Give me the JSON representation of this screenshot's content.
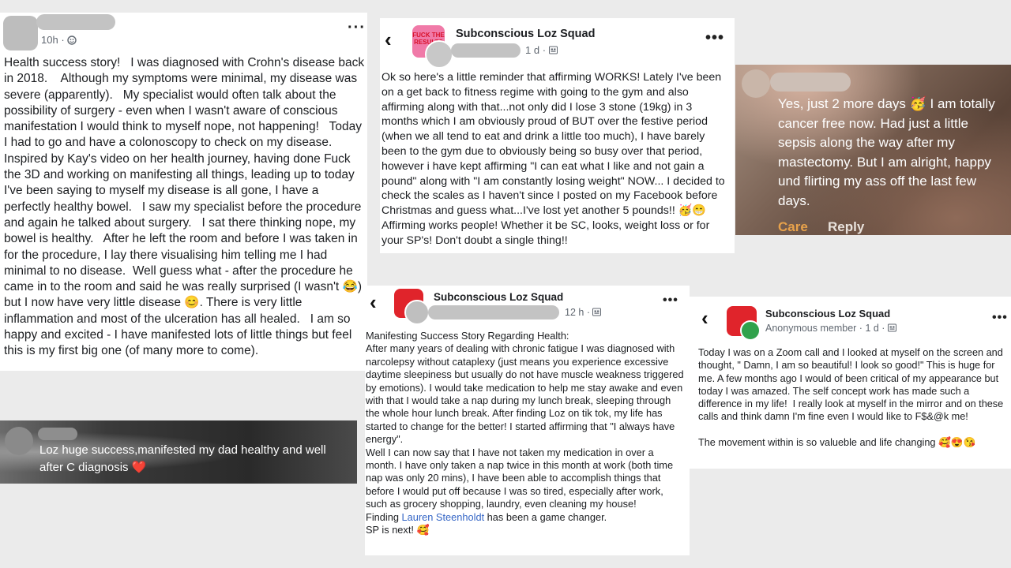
{
  "post1": {
    "time": "10h",
    "text": "Health success story!   I was diagnosed with Crohn's disease back in 2018.    Although my symptoms were minimal, my disease was severe (apparently).   My specialist would often talk about the possibility of surgery - even when I wasn't aware of conscious manifestation I would think to myself nope, not happening!   Today I had to go and have a colonoscopy to check on my disease.   Inspired by Kay's video on her health journey, having done Fuck the 3D and working on manifesting all things, leading up to today I've been saying to myself my disease is all gone, I have a perfectly healthy bowel.   I saw my specialist before the procedure and again he talked about surgery.   I sat there thinking nope, my bowel is healthy.   After he left the room and before I was taken in for the procedure, I lay there visualising him telling me I had minimal to no disease.  Well guess what - after the procedure he came in to the room and said he was really surprised (I wasn't 😂) but I now have very little disease 😊. There is very little inflammation and most of the ulceration has all healed.   I am so happy and excited - I have manifested lots of little things but feel this is my first big one (of many more to come)."
  },
  "post2": {
    "group": "Subconscious Loz Squad",
    "avatar_text": "FUCK THE RESULTS",
    "time": "1 d",
    "text": "Ok so here's a little reminder that affirming WORKS! Lately I've been on a get back to fitness regime with going to the gym and also affirming along with that...not only did I lose 3 stone (19kg) in 3 months which I am obviously proud of BUT over the festive period (when we all tend to eat and drink a little too much), I have barely been to the gym due to obviously being so busy over that period, however i have kept affirming \"I can eat what I like and not gain a pound\" along with \"I am constantly losing weight\" NOW... I decided to check the scales as I haven't since I posted on my Facebook before Christmas and guess what...I've lost yet another 5 pounds!! 🥳😁  Affirming works people! Whether it be SC, looks, weight loss or for your SP's! Don't doubt a single thing!!"
  },
  "post3": {
    "text": "Yes, just 2 more days 🥳 I am totally cancer free now. Had just a little sepsis along the way after my mastectomy. But I am alright, happy und flirting my ass off the last few days.",
    "care_label": "Care",
    "reply_label": "Reply"
  },
  "post4": {
    "text": "Loz huge success,manifested my dad healthy and well after C diagnosis ❤️"
  },
  "post5": {
    "group": "Subconscious Loz Squad",
    "time": "12 h",
    "text_before_link": "Manifesting Success Story Regarding Health:\nAfter many years of dealing with chronic fatigue I was diagnosed with narcolepsy without cataplexy (just means you experience excessive daytime sleepiness but usually do not have muscle weakness triggered by emotions). I would take medication to help me stay awake and even with that I would take a nap during my lunch break, sleeping through the whole hour lunch break. After finding Loz on tik tok, my life has started to change for the better! I started affirming that \"I always have energy\".\nWell I can now say that I have not taken my medication in over a month. I have only taken a nap twice in this month at work (both time nap was only 20 mins), I have been able to accomplish things that before I would put off because I was so tired, especially after work, such as grocery shopping, laundry, even cleaning my house!\nFinding ",
    "link": "Lauren Steenholdt",
    "text_after_link": " has been a game changer.\nSP is next! 🥰"
  },
  "post6": {
    "group": "Subconscious Loz Squad",
    "author": "Anonymous member",
    "time": "1 d",
    "text": "Today I was on a Zoom call and I looked at myself on the screen and thought, \" Damn, I am so beautiful! I look so good!\" This is huge for me. A few months ago I would of been critical of my appearance but today I was amazed. The self concept work has made such a difference in my life!  I really look at myself in the mirror and on these calls and think damn I'm fine even I would like to F$&@k me!\n\nThe movement within is so valueble and life changing 🥰😍😘"
  },
  "colors": {
    "accent_red": "#e0242b",
    "link_blue": "#3566c6",
    "care_orange": "#e8a24b"
  },
  "icons": [
    "more-icon",
    "globe-icon",
    "group-icon",
    "back-icon",
    "anonymous-icon"
  ]
}
